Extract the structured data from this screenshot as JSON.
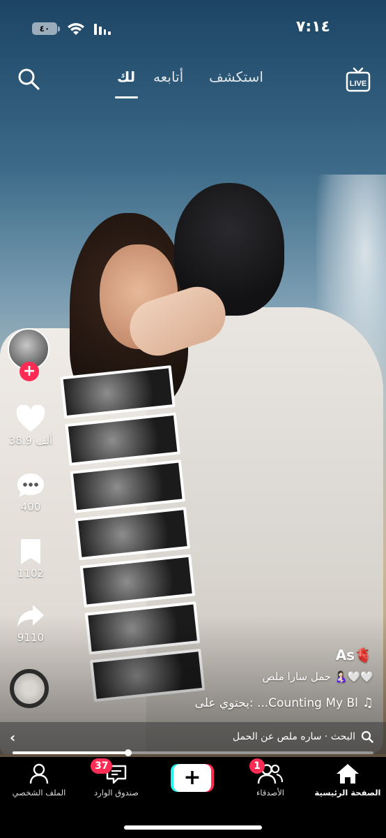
{
  "status_bar": {
    "time": "٧:١٤",
    "battery": "٤٠"
  },
  "top_nav": {
    "live_label": "LIVE",
    "tabs": [
      {
        "label": "استكشف",
        "active": false
      },
      {
        "label": "أتابعه",
        "active": false
      },
      {
        "label": "لك",
        "active": true
      }
    ]
  },
  "actions": {
    "follow_symbol": "+",
    "likes": "38.9 ألف",
    "comments": "400",
    "saves": "1102",
    "shares": "9110"
  },
  "caption": {
    "author": "As",
    "author_emoji": "🫀",
    "description": "حمل سارا ملص",
    "description_emoji": "🤱🏻🤍🤍",
    "music": "يحتوي على: ...Counting My Bl",
    "music_note": "♫"
  },
  "search_suggestion": {
    "text": "البحث · ساره ملص عن الحمل",
    "chevron": "‹"
  },
  "playback": {
    "progress": 0.32
  },
  "tab_bar": {
    "items": [
      {
        "label": "الصفحة الرئيسية",
        "icon": "home-icon",
        "active": true
      },
      {
        "label": "الأصدقاء",
        "icon": "friends-icon",
        "badge": "1"
      },
      {
        "label": "",
        "icon": "create-icon",
        "symbol": "+"
      },
      {
        "label": "صندوق الوارد",
        "icon": "inbox-icon",
        "badge": "37"
      },
      {
        "label": "الملف الشخصي",
        "icon": "profile-icon"
      }
    ]
  },
  "colors": {
    "accent": "#fe2c55",
    "cyan": "#25f4ee"
  }
}
